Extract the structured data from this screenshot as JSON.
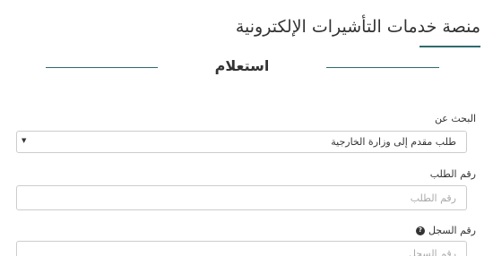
{
  "header": {
    "platform_title": "منصة خدمات التأشيرات الإلكترونية"
  },
  "section": {
    "heading": "استعلام"
  },
  "form": {
    "search_by": {
      "label": "البحث عن",
      "selected": "طلب مقدم إلى وزارة الخارجية"
    },
    "request_number": {
      "label": "رقم الطلب",
      "placeholder": "رقم الطلب"
    },
    "record_number": {
      "label": "رقم السجل",
      "placeholder": "رقم السجل",
      "help_icon": "question-circle-icon"
    }
  },
  "colors": {
    "accent": "#2e6b6e",
    "border": "#cccccc",
    "text": "#333333",
    "placeholder": "#aaaaaa"
  }
}
